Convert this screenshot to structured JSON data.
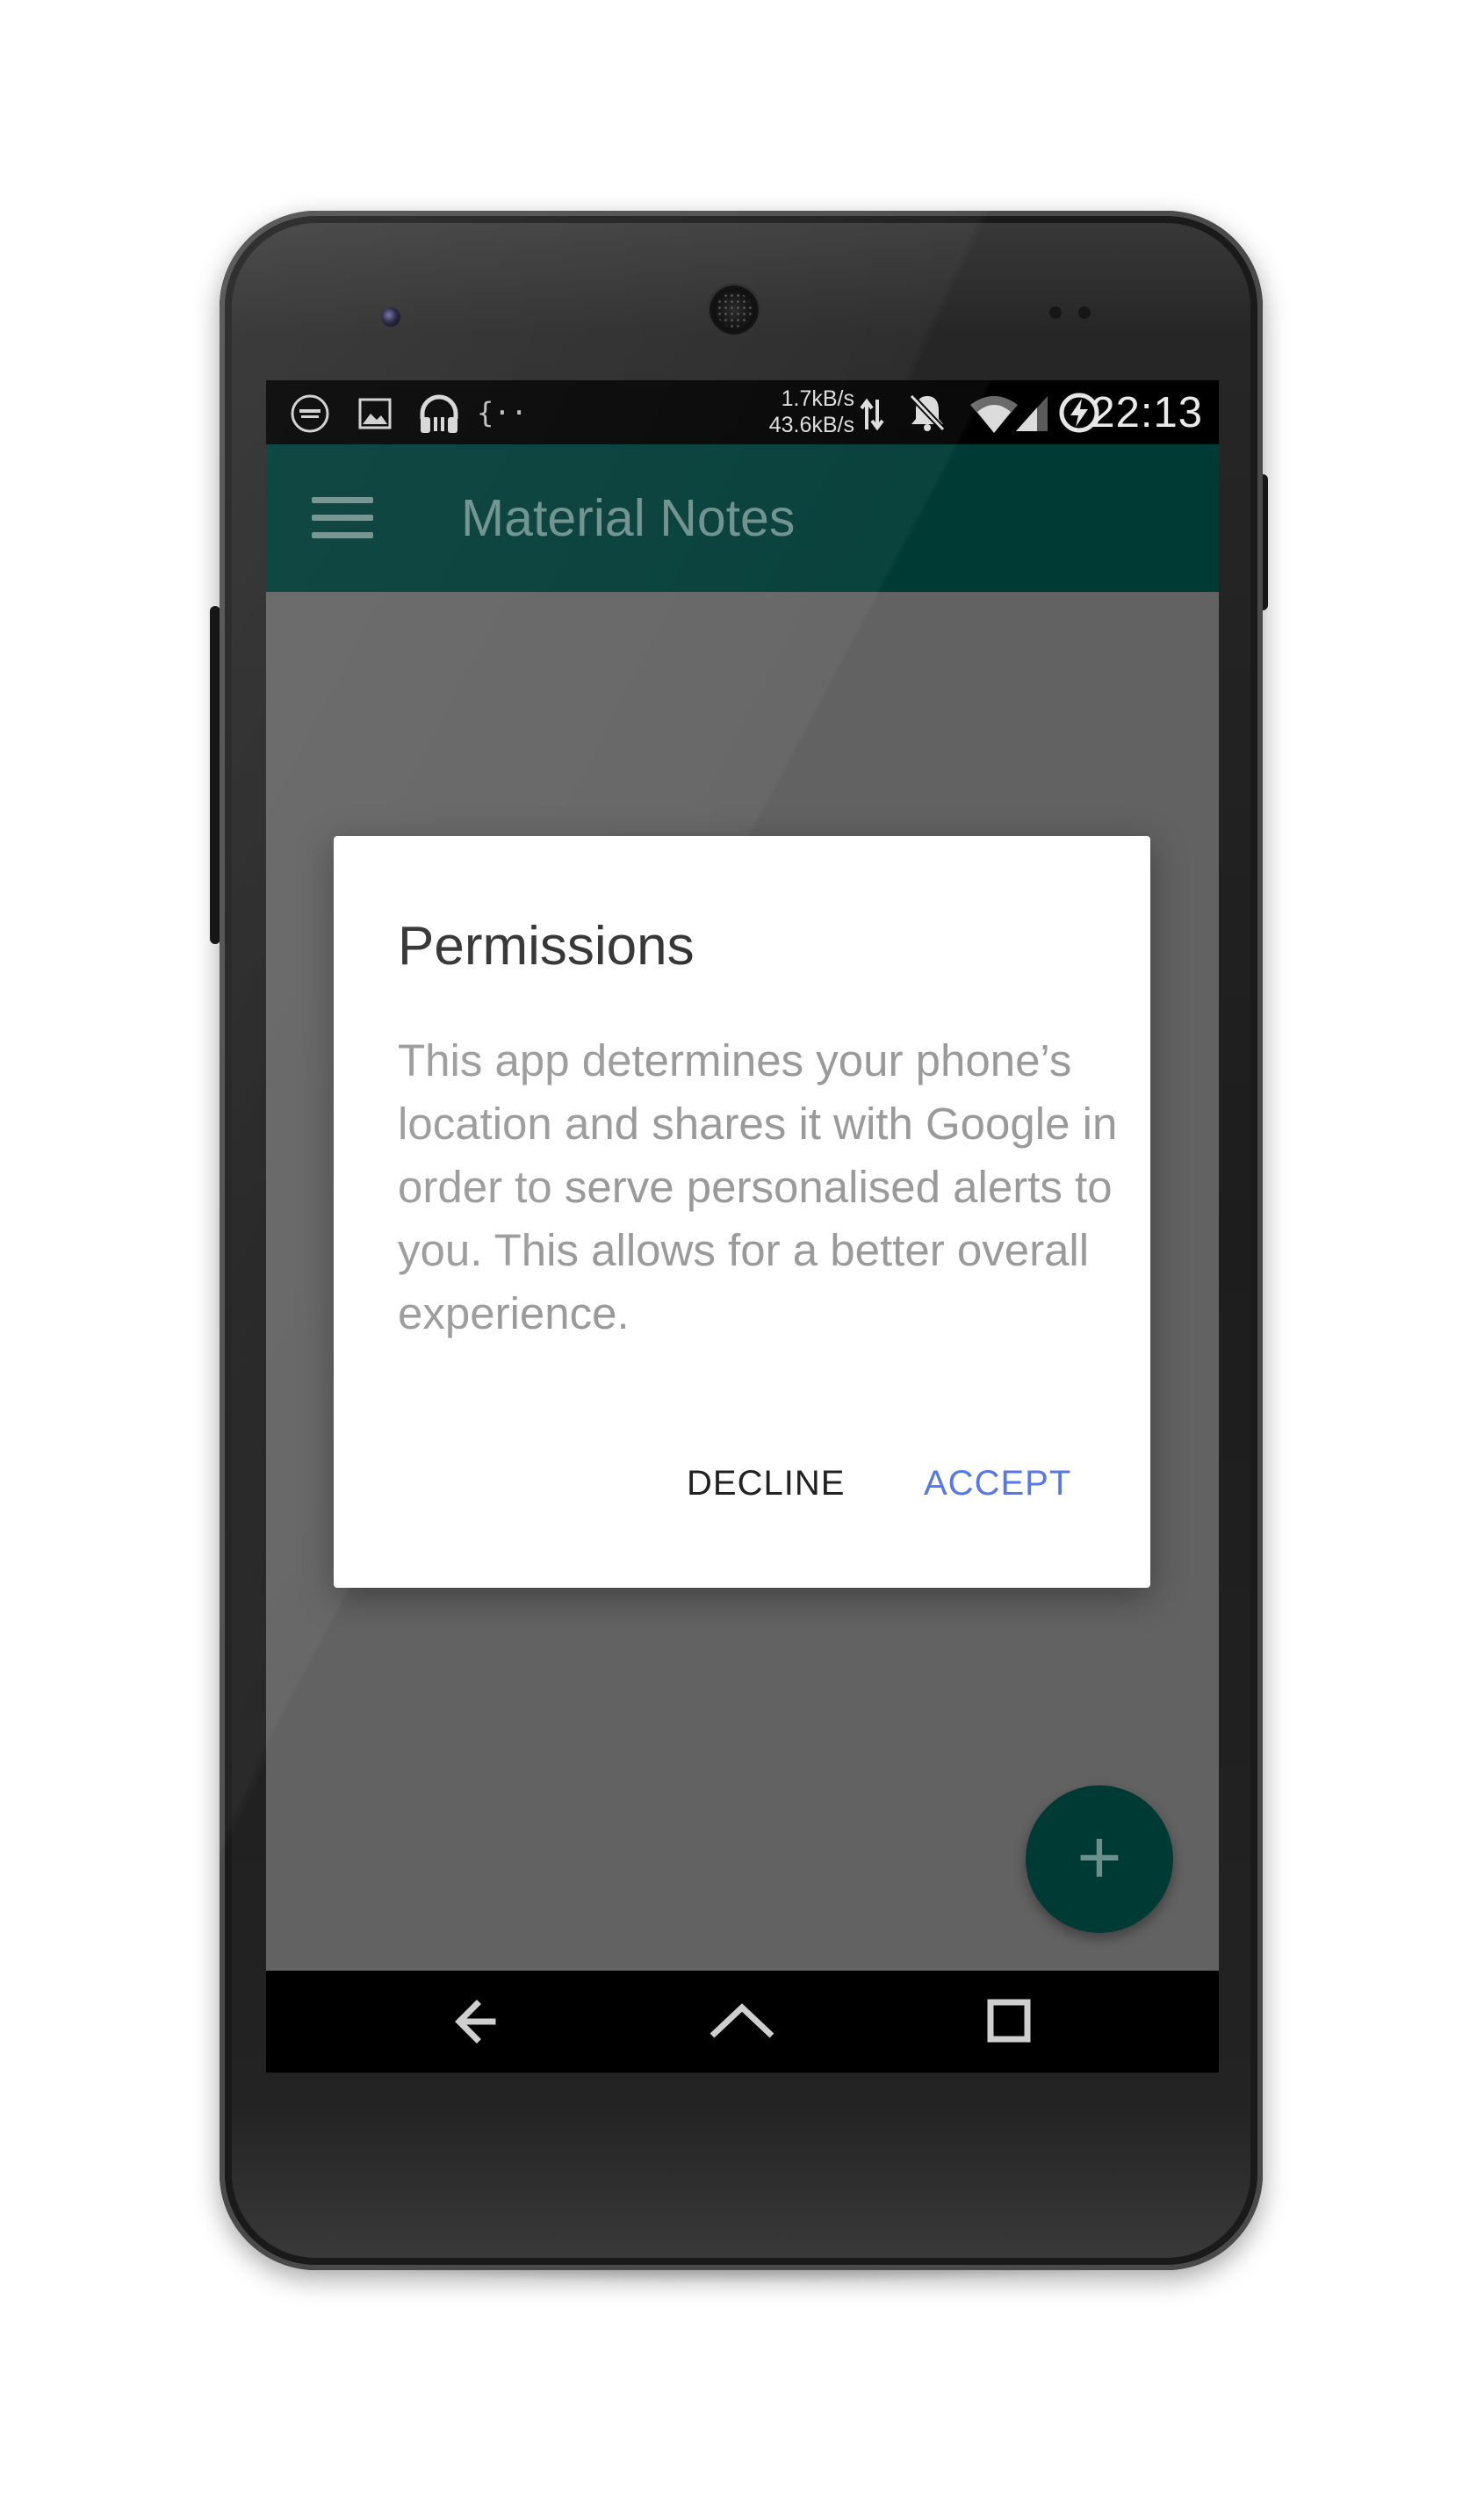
{
  "status_bar": {
    "net_speed_up": "1.7kB/s",
    "net_speed_down": "43.6kB/s",
    "time": "22:13",
    "icons": [
      "music-app-icon",
      "image-icon",
      "headphones-icon",
      "code-braces-icon",
      "data-transfer-icon",
      "notifications-muted-icon",
      "wifi-icon",
      "signal-icon",
      "battery-charging-icon"
    ]
  },
  "app_bar": {
    "title": "Material Notes",
    "menu_icon": "hamburger-menu-icon"
  },
  "dialog": {
    "title": "Permissions",
    "message": "This app determines your phone’s location and shares it with Google in order to serve personalised alerts to you. This allows for a better overall experience.",
    "decline_label": "DECLINE",
    "accept_label": "ACCEPT"
  },
  "fab": {
    "label": "+",
    "icon": "plus-icon"
  },
  "nav_bar": {
    "icons": [
      "back-icon",
      "home-icon",
      "recents-icon"
    ]
  },
  "colors": {
    "app_bar": "#003a35",
    "scrim": "#626262",
    "accent": "#5577e8"
  }
}
